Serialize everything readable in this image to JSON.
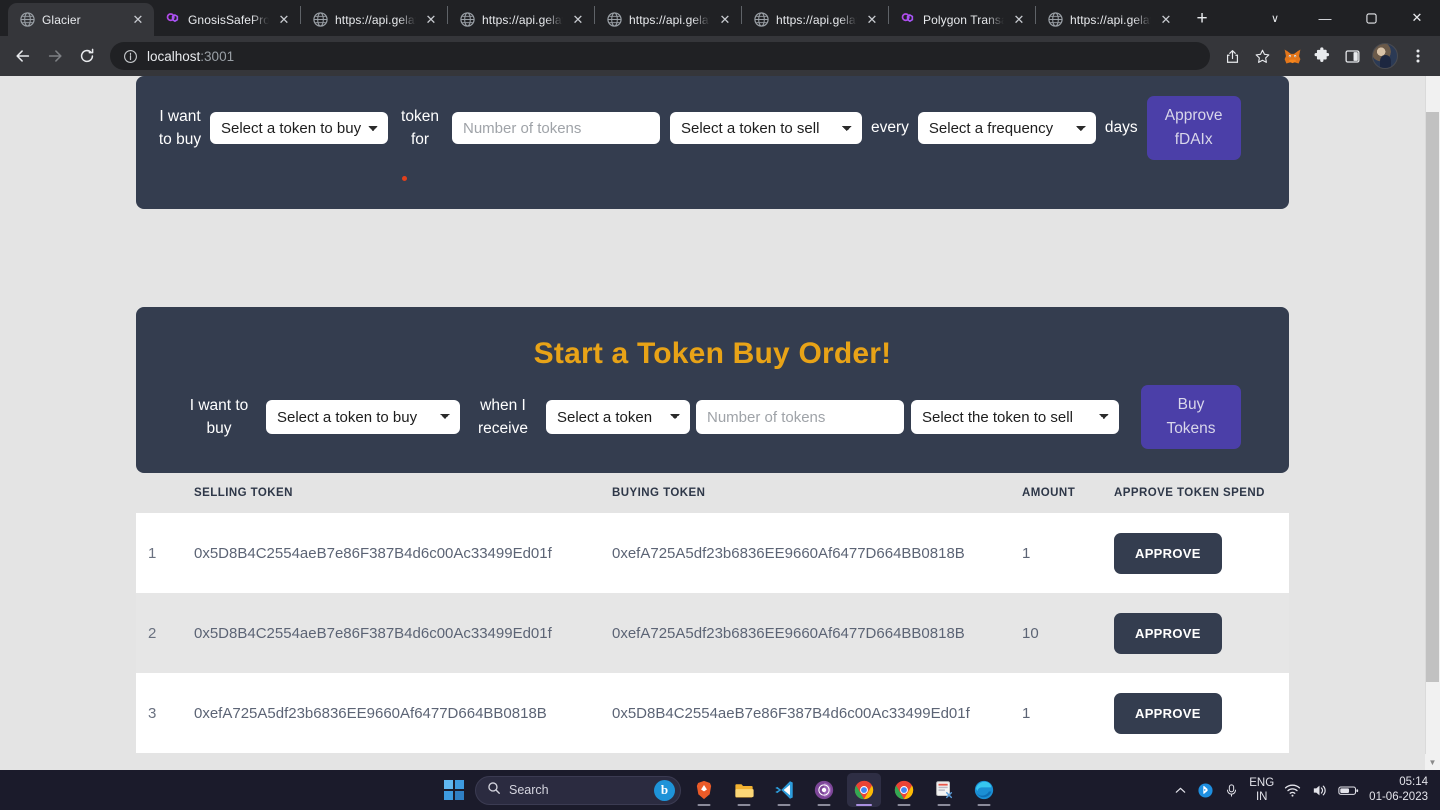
{
  "browser": {
    "tabs": [
      {
        "title": "Glacier",
        "favicon": "globe-icon",
        "active": true
      },
      {
        "title": "GnosisSafeProxy",
        "favicon": "polygon-icon",
        "active": false
      },
      {
        "title": "https://api.gelato",
        "favicon": "globe-icon",
        "active": false
      },
      {
        "title": "https://api.gelato",
        "favicon": "globe-icon",
        "active": false
      },
      {
        "title": "https://api.gelato",
        "favicon": "globe-icon",
        "active": false
      },
      {
        "title": "https://api.gelato",
        "favicon": "globe-icon",
        "active": false
      },
      {
        "title": "Polygon Transac",
        "favicon": "polygon-icon",
        "active": false
      },
      {
        "title": "https://api.gelato",
        "favicon": "globe-icon",
        "active": false
      }
    ],
    "new_tab_label": "+",
    "window_controls": {
      "chevron": "∨",
      "minimize": "—",
      "maximize": "❐",
      "close": "✕"
    },
    "nav": {
      "back": "←",
      "forward": "→",
      "reload": "⟳"
    },
    "omnibox": {
      "info_icon": "site-info-icon",
      "host": "localhost",
      "port": ":3001"
    },
    "toolbar_icons": [
      "share-icon",
      "bookmark-star-icon",
      "metamask-fox-icon",
      "extensions-puzzle-icon",
      "side-panel-icon",
      "profile-avatar",
      "chrome-menu-icon"
    ]
  },
  "panel_dca": {
    "label_1": "I want to buy",
    "token_buy_select": "Select a token to buy",
    "label_2": "token for",
    "amount_placeholder": "Number of tokens",
    "token_sell_select": "Select a token to sell",
    "label_3": "every",
    "frequency_select": "Select a frequency",
    "label_4": "days",
    "approve_button": "Approve fDAIx"
  },
  "panel_buy": {
    "title": "Start a Token Buy Order!",
    "label_1": "I want to buy",
    "token_buy_select": "Select a token to buy",
    "label_2": "when I receive",
    "token_select": "Select a token",
    "amount_placeholder": "Number of tokens",
    "token_sell_select": "Select the token to sell",
    "buy_button": "Buy Tokens"
  },
  "table": {
    "headers": {
      "index": "",
      "selling": "SELLING TOKEN",
      "buying": "BUYING TOKEN",
      "amount": "AMOUNT",
      "action": "APPROVE TOKEN SPEND"
    },
    "rows": [
      {
        "index": "1",
        "selling": "0x5D8B4C2554aeB7e86F387B4d6c00Ac33499Ed01f",
        "buying": "0xefA725A5df23b6836EE9660Af6477D664BB0818B",
        "amount": "1",
        "action": "APPROVE"
      },
      {
        "index": "2",
        "selling": "0x5D8B4C2554aeB7e86F387B4d6c00Ac33499Ed01f",
        "buying": "0xefA725A5df23b6836EE9660Af6477D664BB0818B",
        "amount": "10",
        "action": "APPROVE"
      },
      {
        "index": "3",
        "selling": "0xefA725A5df23b6836EE9660Af6477D664BB0818B",
        "buying": "0x5D8B4C2554aeB7e86F387B4d6c00Ac33499Ed01f",
        "amount": "1",
        "action": "APPROVE"
      }
    ]
  },
  "taskbar": {
    "search_placeholder": "Search",
    "bing_glyph": "b",
    "apps": [
      "brave-icon",
      "file-explorer-icon",
      "vscode-icon",
      "tor-browser-icon",
      "chrome-icon",
      "chrome-icon",
      "snipping-tool-icon",
      "edge-icon"
    ],
    "tray": {
      "chevron": "∧",
      "language_line1": "ENG",
      "language_line2": "IN",
      "time": "05:14",
      "date": "01-06-2023"
    }
  },
  "colors": {
    "panel_bg": "#343D4F",
    "page_bg": "#E4E4E4",
    "accent_orange": "#E8A317",
    "accent_purple": "#4B3FA8",
    "row_alt": "#E6E6E6"
  }
}
